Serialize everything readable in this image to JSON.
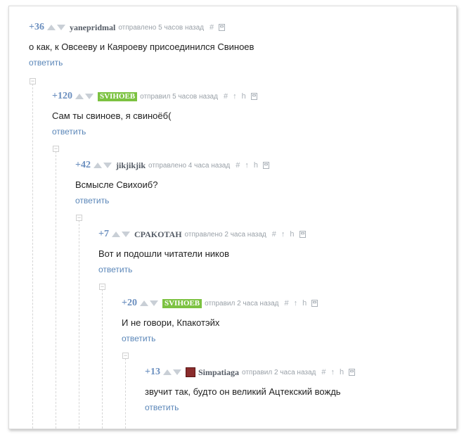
{
  "comments": [
    {
      "rating": "+36",
      "user": "yanepridmal",
      "meta": "отправлено 5 часов назад",
      "text": "о как, к Овсееву и Каяроеву присоединился Свиноев",
      "reply": "ответить"
    },
    {
      "rating": "+120",
      "user": "SVIHOEB",
      "meta": "отправил 5 часов назад",
      "text": "Сам ты свиноев, я свиноёб(",
      "reply": "ответить"
    },
    {
      "rating": "+42",
      "user": "jikjikjik",
      "meta": "отправлено 4 часа назад",
      "text": "Всмысле Свихоиб?",
      "reply": "ответить"
    },
    {
      "rating": "+7",
      "user": "CPAKOTAH",
      "meta": "отправлено 2 часа назад",
      "text": "Вот и подошли читатели ников",
      "reply": "ответить"
    },
    {
      "rating": "+20",
      "user": "SVIHOEB",
      "meta": "отправил 2 часа назад",
      "text": "И не говори, Кпакотэйх",
      "reply": "ответить"
    },
    {
      "rating": "+13",
      "user": "Simpatiaga",
      "meta": "отправил 2 часа назад",
      "text": "звучит так, будто он великий Ацтекский вождь",
      "reply": "ответить"
    }
  ],
  "icons": {
    "hash": "#",
    "up_arrow": "↑",
    "branch": "h"
  },
  "colors": {
    "rating": "#6b8fbf",
    "badge_green": "#7cc241",
    "reply_link": "#5a86b8",
    "meta": "#9aa1a8"
  }
}
